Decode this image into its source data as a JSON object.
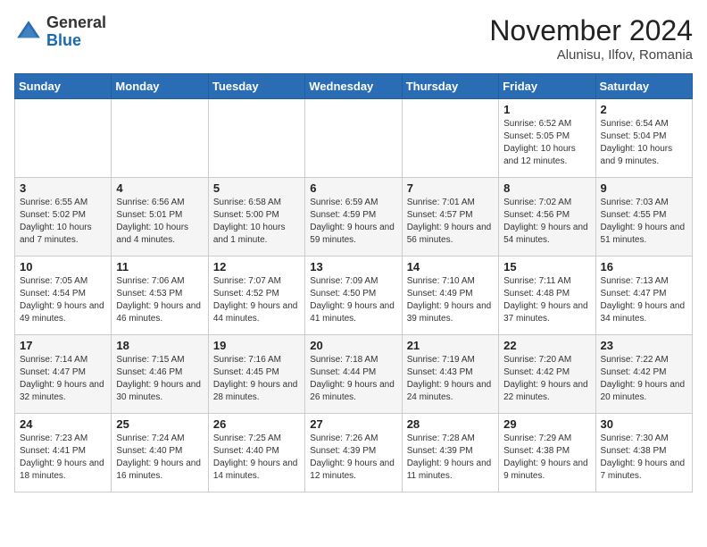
{
  "header": {
    "logo_general": "General",
    "logo_blue": "Blue",
    "month_title": "November 2024",
    "location": "Alunisu, Ilfov, Romania"
  },
  "weekdays": [
    "Sunday",
    "Monday",
    "Tuesday",
    "Wednesday",
    "Thursday",
    "Friday",
    "Saturday"
  ],
  "weeks": [
    [
      {
        "day": "",
        "info": ""
      },
      {
        "day": "",
        "info": ""
      },
      {
        "day": "",
        "info": ""
      },
      {
        "day": "",
        "info": ""
      },
      {
        "day": "",
        "info": ""
      },
      {
        "day": "1",
        "info": "Sunrise: 6:52 AM\nSunset: 5:05 PM\nDaylight: 10 hours and 12 minutes."
      },
      {
        "day": "2",
        "info": "Sunrise: 6:54 AM\nSunset: 5:04 PM\nDaylight: 10 hours and 9 minutes."
      }
    ],
    [
      {
        "day": "3",
        "info": "Sunrise: 6:55 AM\nSunset: 5:02 PM\nDaylight: 10 hours and 7 minutes."
      },
      {
        "day": "4",
        "info": "Sunrise: 6:56 AM\nSunset: 5:01 PM\nDaylight: 10 hours and 4 minutes."
      },
      {
        "day": "5",
        "info": "Sunrise: 6:58 AM\nSunset: 5:00 PM\nDaylight: 10 hours and 1 minute."
      },
      {
        "day": "6",
        "info": "Sunrise: 6:59 AM\nSunset: 4:59 PM\nDaylight: 9 hours and 59 minutes."
      },
      {
        "day": "7",
        "info": "Sunrise: 7:01 AM\nSunset: 4:57 PM\nDaylight: 9 hours and 56 minutes."
      },
      {
        "day": "8",
        "info": "Sunrise: 7:02 AM\nSunset: 4:56 PM\nDaylight: 9 hours and 54 minutes."
      },
      {
        "day": "9",
        "info": "Sunrise: 7:03 AM\nSunset: 4:55 PM\nDaylight: 9 hours and 51 minutes."
      }
    ],
    [
      {
        "day": "10",
        "info": "Sunrise: 7:05 AM\nSunset: 4:54 PM\nDaylight: 9 hours and 49 minutes."
      },
      {
        "day": "11",
        "info": "Sunrise: 7:06 AM\nSunset: 4:53 PM\nDaylight: 9 hours and 46 minutes."
      },
      {
        "day": "12",
        "info": "Sunrise: 7:07 AM\nSunset: 4:52 PM\nDaylight: 9 hours and 44 minutes."
      },
      {
        "day": "13",
        "info": "Sunrise: 7:09 AM\nSunset: 4:50 PM\nDaylight: 9 hours and 41 minutes."
      },
      {
        "day": "14",
        "info": "Sunrise: 7:10 AM\nSunset: 4:49 PM\nDaylight: 9 hours and 39 minutes."
      },
      {
        "day": "15",
        "info": "Sunrise: 7:11 AM\nSunset: 4:48 PM\nDaylight: 9 hours and 37 minutes."
      },
      {
        "day": "16",
        "info": "Sunrise: 7:13 AM\nSunset: 4:47 PM\nDaylight: 9 hours and 34 minutes."
      }
    ],
    [
      {
        "day": "17",
        "info": "Sunrise: 7:14 AM\nSunset: 4:47 PM\nDaylight: 9 hours and 32 minutes."
      },
      {
        "day": "18",
        "info": "Sunrise: 7:15 AM\nSunset: 4:46 PM\nDaylight: 9 hours and 30 minutes."
      },
      {
        "day": "19",
        "info": "Sunrise: 7:16 AM\nSunset: 4:45 PM\nDaylight: 9 hours and 28 minutes."
      },
      {
        "day": "20",
        "info": "Sunrise: 7:18 AM\nSunset: 4:44 PM\nDaylight: 9 hours and 26 minutes."
      },
      {
        "day": "21",
        "info": "Sunrise: 7:19 AM\nSunset: 4:43 PM\nDaylight: 9 hours and 24 minutes."
      },
      {
        "day": "22",
        "info": "Sunrise: 7:20 AM\nSunset: 4:42 PM\nDaylight: 9 hours and 22 minutes."
      },
      {
        "day": "23",
        "info": "Sunrise: 7:22 AM\nSunset: 4:42 PM\nDaylight: 9 hours and 20 minutes."
      }
    ],
    [
      {
        "day": "24",
        "info": "Sunrise: 7:23 AM\nSunset: 4:41 PM\nDaylight: 9 hours and 18 minutes."
      },
      {
        "day": "25",
        "info": "Sunrise: 7:24 AM\nSunset: 4:40 PM\nDaylight: 9 hours and 16 minutes."
      },
      {
        "day": "26",
        "info": "Sunrise: 7:25 AM\nSunset: 4:40 PM\nDaylight: 9 hours and 14 minutes."
      },
      {
        "day": "27",
        "info": "Sunrise: 7:26 AM\nSunset: 4:39 PM\nDaylight: 9 hours and 12 minutes."
      },
      {
        "day": "28",
        "info": "Sunrise: 7:28 AM\nSunset: 4:39 PM\nDaylight: 9 hours and 11 minutes."
      },
      {
        "day": "29",
        "info": "Sunrise: 7:29 AM\nSunset: 4:38 PM\nDaylight: 9 hours and 9 minutes."
      },
      {
        "day": "30",
        "info": "Sunrise: 7:30 AM\nSunset: 4:38 PM\nDaylight: 9 hours and 7 minutes."
      }
    ]
  ]
}
